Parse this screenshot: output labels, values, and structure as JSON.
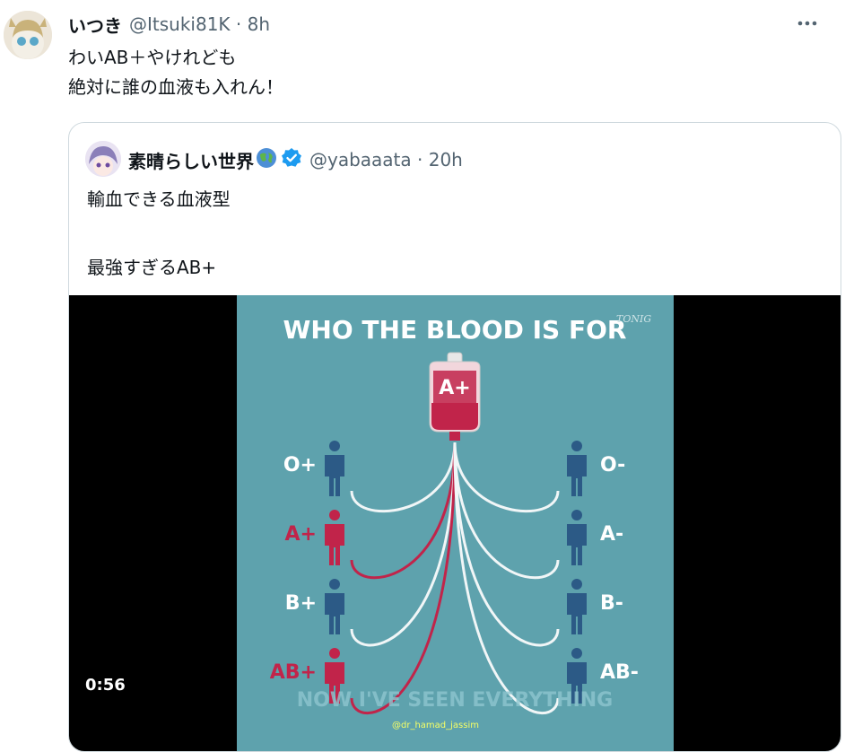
{
  "tweet": {
    "display_name": "いつき",
    "handle": "@Itsuki81K",
    "time": "8h",
    "text_line1": "わいAB＋やけれども",
    "text_line2": "絶対に誰の血液も入れん！"
  },
  "quote": {
    "display_name": "素晴らしい世界",
    "handle": "@yabaaata",
    "time": "20h",
    "text_line1": "輸血できる血液型",
    "text_line2": "",
    "text_line3": "最強すぎるAB+"
  },
  "video": {
    "title": "WHO THE BLOOD IS FOR",
    "watermark": "TONIG",
    "bag_label": "A+",
    "left_types": [
      "O+",
      "A+",
      "B+",
      "AB+"
    ],
    "right_types": [
      "O-",
      "A-",
      "B-",
      "AB-"
    ],
    "left_colors": [
      "#2c5a86",
      "#c1244a",
      "#2c5a86",
      "#c1244a"
    ],
    "right_colors": [
      "#2c5a86",
      "#2c5a86",
      "#2c5a86",
      "#2c5a86"
    ],
    "caption": "NOW I'VE SEEN EVERYTHING",
    "credit": "@dr_hamad_jassim",
    "duration": "0:56",
    "panel_bg": "#5ea2ad"
  },
  "colors": {
    "text_primary": "#0f1419",
    "text_secondary": "#536471",
    "verified": "#1d9bf0",
    "red": "#c1244a",
    "blue": "#2c5a86"
  },
  "icons": {
    "more": "ellipsis-icon",
    "verified": "verified-badge-icon",
    "globe": "globe-emoji-icon"
  }
}
